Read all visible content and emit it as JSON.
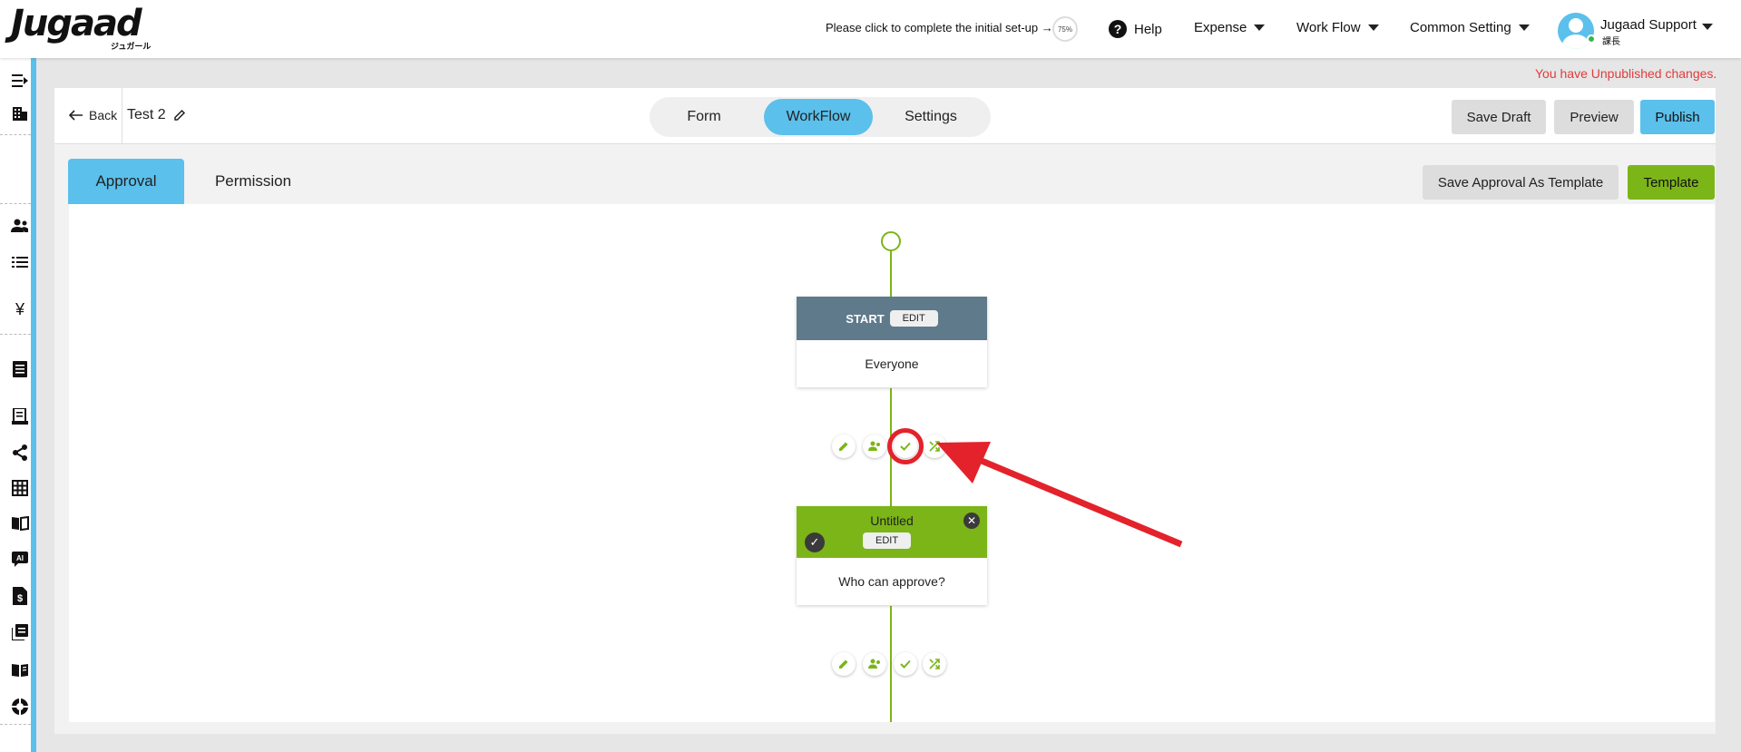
{
  "app": {
    "logo_text": "Jugaad",
    "logo_subtext": "ジュガール"
  },
  "topbar": {
    "setup_text": "Please click to complete the initial set-up →",
    "setup_progress": "75%",
    "help_label": "Help",
    "expense_label": "Expense",
    "workflow_label": "Work Flow",
    "common_setting_label": "Common Setting",
    "user_name": "Jugaad Support",
    "user_role": "課長"
  },
  "notice": {
    "unpublished": "You have Unpublished changes."
  },
  "header": {
    "back_label": "Back",
    "form_title": "Test 2",
    "tabs": [
      {
        "label": "Form"
      },
      {
        "label": "WorkFlow"
      },
      {
        "label": "Settings"
      }
    ],
    "active_tab": "WorkFlow",
    "save_draft_label": "Save Draft",
    "preview_label": "Preview",
    "publish_label": "Publish"
  },
  "subtabs": {
    "approval_label": "Approval",
    "permission_label": "Permission",
    "save_template_label": "Save Approval As Template",
    "template_label": "Template"
  },
  "workflow": {
    "start_node": {
      "label": "START",
      "edit_label": "EDIT",
      "body": "Everyone"
    },
    "approval_node": {
      "title": "Untitled",
      "edit_label": "EDIT",
      "body": "Who can approve?"
    },
    "actions": [
      "pencil-icon",
      "users-icon",
      "check-icon",
      "shuffle-icon"
    ]
  },
  "colors": {
    "accent_blue": "#5bc0eb",
    "accent_green": "#7cb518",
    "start_header": "#5f7a8a",
    "annotation_red": "#e3222b",
    "warning_text": "#e23b3b"
  }
}
